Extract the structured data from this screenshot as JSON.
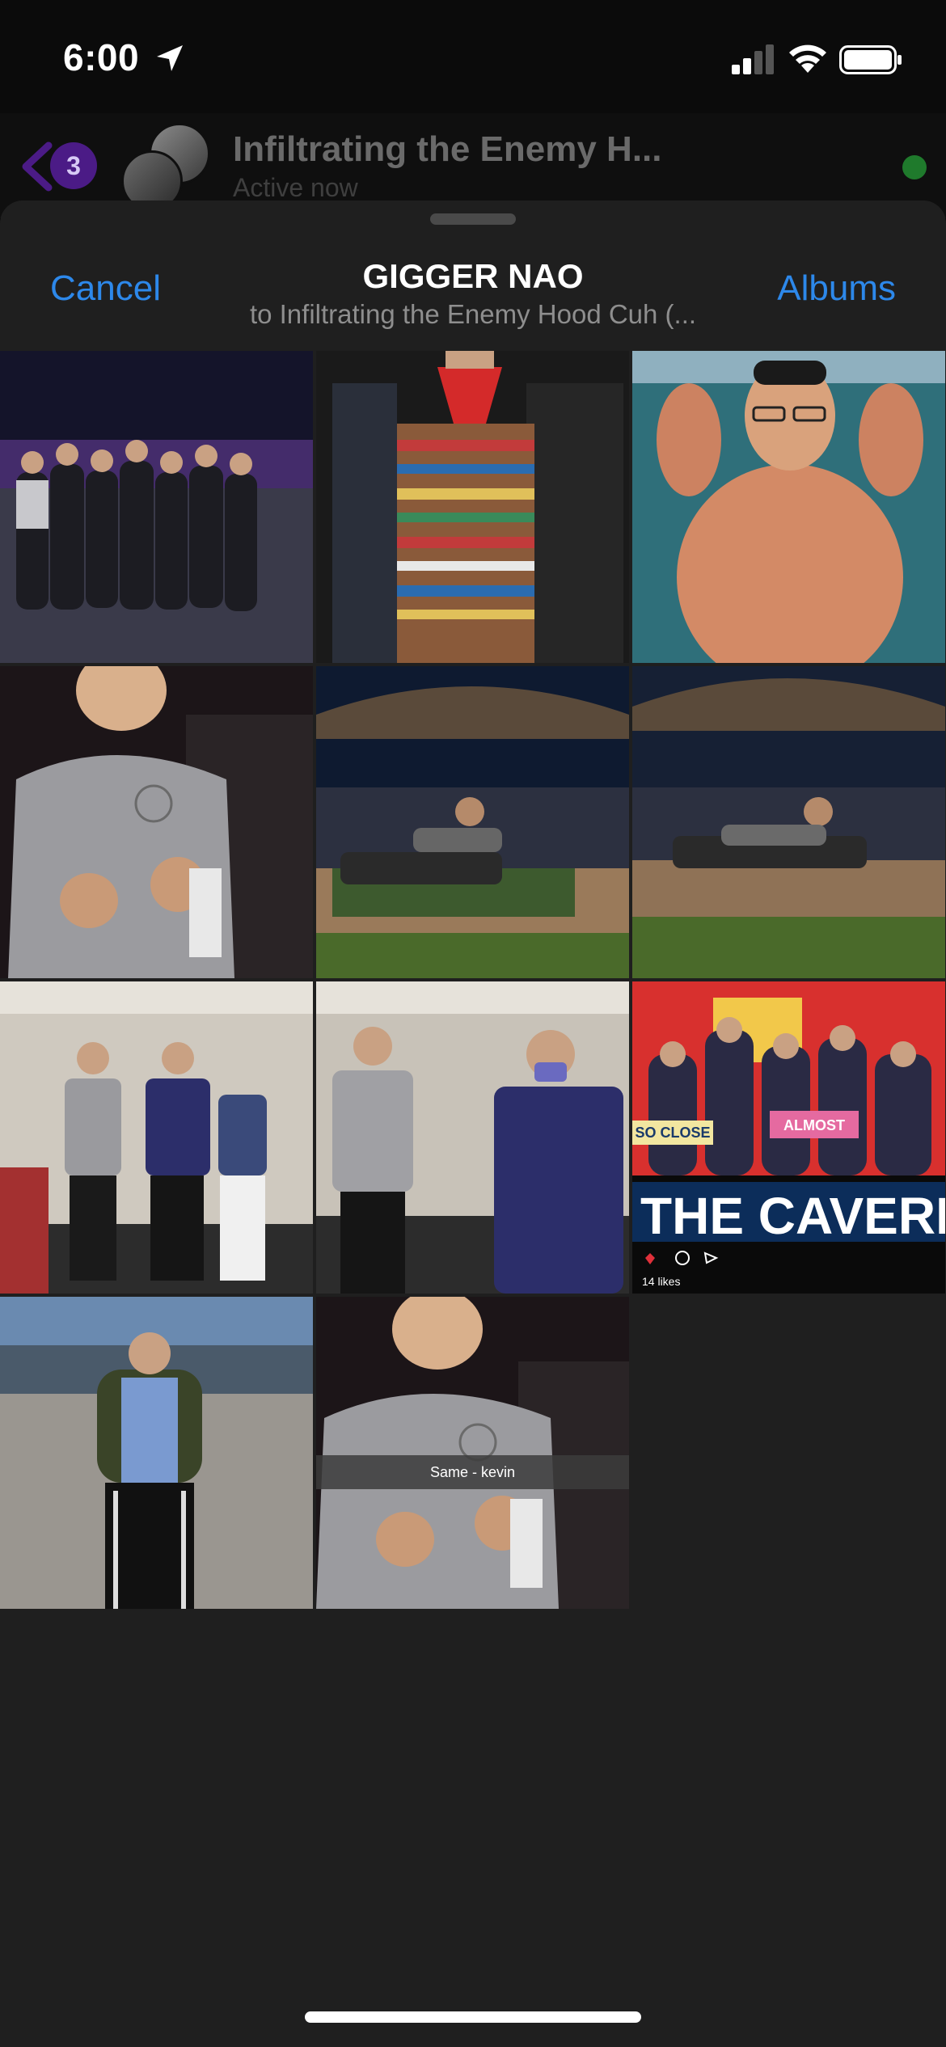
{
  "status_bar": {
    "time": "6:00"
  },
  "chat_header": {
    "unread_count": "3",
    "title": "Infiltrating the Enemy H...",
    "status": "Active now"
  },
  "sheet": {
    "cancel_label": "Cancel",
    "title": "GIGGER NAO",
    "subtitle": "to Infiltrating the Enemy Hood Cuh (...",
    "albums_label": "Albums"
  },
  "photos": {
    "caption_11": "Same - kevin",
    "poster_text": "THE CAVERN",
    "poster_sign_1": "SO CLOSE",
    "poster_sign_2": "ALMOST",
    "poster_likes": "14 likes"
  },
  "colors": {
    "accent": "#2d88ea",
    "sheet_bg": "#1f1f1f",
    "messenger_purple": "#6a1fd1"
  }
}
